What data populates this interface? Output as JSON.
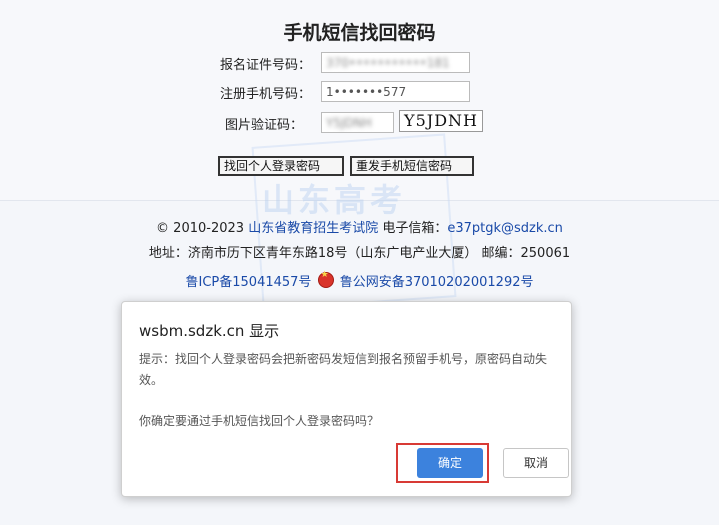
{
  "page": {
    "title": "手机短信找回密码",
    "form": {
      "id_label": "报名证件号码：",
      "id_value": "370•••••••••••181",
      "phone_label": "注册手机号码：",
      "phone_value": "1•••••••577",
      "captcha_label": "图片验证码：",
      "captcha_input_value": "Y5JDNH",
      "captcha_image_text": "Y5JDNH"
    },
    "buttons": {
      "recover": "找回个人登录密码",
      "resend": "重发手机短信密码"
    }
  },
  "footer": {
    "copyright": "© 2010-2023",
    "institution": "山东省教育招生考试院",
    "email_label": "电子信箱：",
    "email": "e37ptgk@sdzk.cn",
    "address": "地址：济南市历下区青年东路18号（山东广电产业大厦） 邮编：250061",
    "icp": "鲁ICP备15041457号",
    "police": "鲁公网安备37010202001292号"
  },
  "watermark": {
    "text": "山东高考"
  },
  "dialog": {
    "title": "wsbm.sdzk.cn 显示",
    "message": "提示：找回个人登录密码会把新密码发短信到报名预留手机号，原密码自动失效。",
    "question": "你确定要通过手机短信找回个人登录密码吗？",
    "ok_label": "确定",
    "cancel_label": "取消"
  },
  "colors": {
    "accent": "#3c82dd",
    "highlight": "#d83a35",
    "link": "#1a4aa8"
  },
  "icons": {
    "police_badge": "police-badge-icon"
  }
}
